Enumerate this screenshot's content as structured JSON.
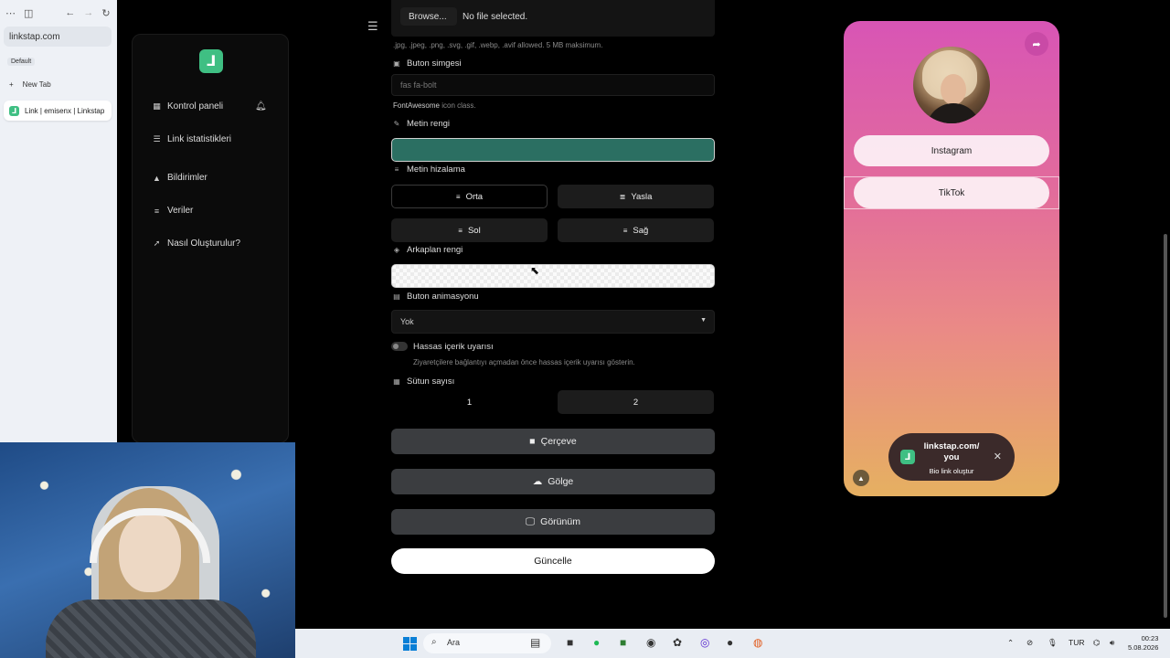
{
  "browser": {
    "address": "linkstap.com",
    "workspace": "Default",
    "new_tab": "New Tab",
    "active_tab": "Link | emisenx | Linkstap"
  },
  "sidebar": {
    "logo_letter": "L",
    "items": [
      {
        "icon": "grid-icon",
        "label": "Kontrol paneli"
      },
      {
        "icon": "list-icon",
        "label": "Link istatistikleri"
      },
      {
        "icon": "bell-icon",
        "label": "Bildirimler"
      },
      {
        "icon": "database-icon",
        "label": "Veriler"
      },
      {
        "icon": "rocket-icon",
        "label": "Nasıl Oluşturulur?"
      }
    ]
  },
  "form": {
    "browse_label": "Browse...",
    "no_file": "No file selected.",
    "file_hint": ".jpg, .jpeg, .png, .svg, .gif, .webp, .avif allowed. 5 MB maksimum.",
    "icon_label": "Buton simgesi",
    "icon_placeholder": "fas fa-bolt",
    "icon_hint_main": "FontAwesome",
    "icon_hint_rest": " icon class.",
    "text_color_label": "Metin rengi",
    "text_color_value": "#2b6f62",
    "align_label": "Metin hizalama",
    "align_options": [
      "Orta",
      "Yasla",
      "Sol",
      "Sağ"
    ],
    "align_selected": "Orta",
    "bg_color_label": "Arkaplan rengi",
    "animation_label": "Buton animasyonu",
    "animation_value": "Yok",
    "sensitive_label": "Hassas içerik uyarısı",
    "sensitive_desc": "Ziyaretçilere bağlantıyı açmadan önce hassas içerik uyarısı gösterin.",
    "columns_label": "Sütun sayısı",
    "columns_options": [
      "1",
      "2"
    ],
    "columns_selected": "1",
    "border_label": "Çerçeve",
    "shadow_label": "Gölge",
    "view_label": "Görünüm",
    "update_label": "Güncelle"
  },
  "preview": {
    "links": [
      "Instagram",
      "TikTok"
    ],
    "toast_title": "linkstap.com/\nyou",
    "toast_sub": "Bio link oluştur",
    "accent": "#d855b5"
  },
  "taskbar": {
    "search_placeholder": "Ara",
    "lang": "TUR",
    "time": "00:23",
    "date": "5.08.2026"
  }
}
